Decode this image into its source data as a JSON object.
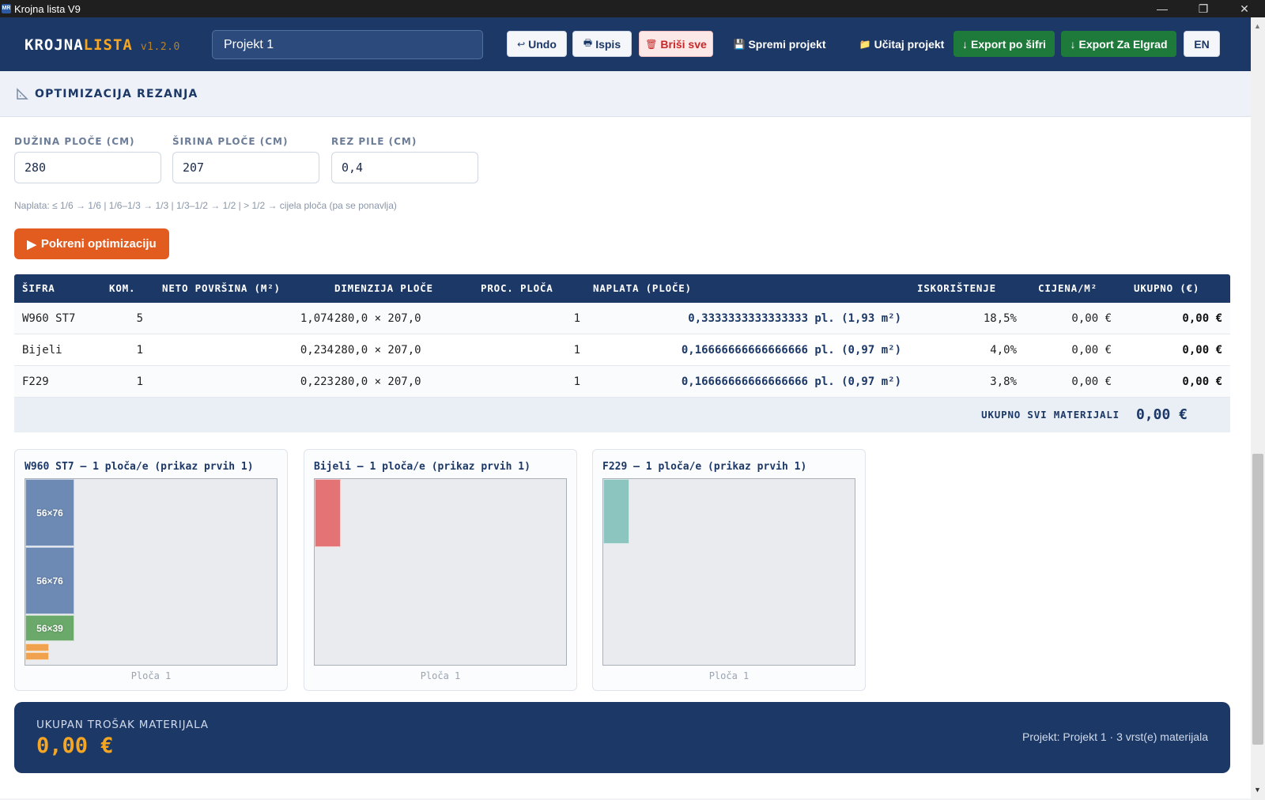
{
  "window": {
    "title": "Krojna lista V9",
    "controls": {
      "minimize": "—",
      "maximize": "❐",
      "close": "✕"
    }
  },
  "header": {
    "logo_main": "KROJNA",
    "logo_accent": "LISTA",
    "version": "v1.2.0",
    "project_name": "Projekt 1",
    "buttons": {
      "undo": "Undo",
      "print": "Ispis",
      "delete_all": "Briši sve",
      "save": "Spremi projekt",
      "load": "Učitaj projekt",
      "export_code": "Export po šifri",
      "export_elgrad": "Export Za Elgrad",
      "lang": "EN"
    },
    "icons": {
      "undo": "↩",
      "print": "🖶",
      "delete": "🗑",
      "save": "💾",
      "load": "📁",
      "export": "↓"
    }
  },
  "section": {
    "title": "OPTIMIZACIJA REZANJA",
    "fields": {
      "length_label": "DUŽINA PLOČE (CM)",
      "length_value": "280",
      "width_label": "ŠIRINA PLOČE (CM)",
      "width_value": "207",
      "kerf_label": "REZ PILE (CM)",
      "kerf_value": "0,4"
    },
    "hint": "Naplata: ≤ 1/6 → 1/6  |  1/6–1/3 → 1/3  |  1/3–1/2 → 1/2  |  > 1/2 → cijela ploča (pa se ponavlja)",
    "run_label": "Pokreni optimizaciju",
    "run_icon": "▶"
  },
  "table": {
    "headers": [
      "ŠIFRA",
      "KOM.",
      "NETO POVRŠINA (M²)",
      "DIMENZIJA PLOČE",
      "PROC. PLOČA",
      "NAPLATA (PLOČE)",
      "ISKORIŠTENJE",
      "CIJENA/M²",
      "UKUPNO (€)"
    ],
    "rows": [
      {
        "code": "W960 ST7",
        "qty": "5",
        "net": "1,074",
        "dim": "280,0 × 207,0",
        "est": "1",
        "billing": "0,3333333333333333 pl. (1,93 m²)",
        "util": "18,5%",
        "price": "0,00 €",
        "total": "0,00 €"
      },
      {
        "code": "Bijeli",
        "qty": "1",
        "net": "0,234",
        "dim": "280,0 × 207,0",
        "est": "1",
        "billing": "0,16666666666666666 pl. (0,97 m²)",
        "util": "4,0%",
        "price": "0,00 €",
        "total": "0,00 €"
      },
      {
        "code": "F229",
        "qty": "1",
        "net": "0,223",
        "dim": "280,0 × 207,0",
        "est": "1",
        "billing": "0,16666666666666666 pl. (0,97 m²)",
        "util": "3,8%",
        "price": "0,00 €",
        "total": "0,00 €"
      }
    ],
    "footer_label": "UKUPNO SVI MATERIJALI",
    "footer_value": "0,00 €"
  },
  "cards": [
    {
      "title": "W960 ST7 — 1 ploča/e (prikaz prvih 1)",
      "plate_label": "Ploča 1",
      "pieces": [
        "56×76",
        "56×76",
        "56×39"
      ]
    },
    {
      "title": "Bijeli — 1 ploča/e (prikaz prvih 1)",
      "plate_label": "Ploča 1"
    },
    {
      "title": "F229 — 1 ploča/e (prikaz prvih 1)",
      "plate_label": "Ploča 1"
    }
  ],
  "summary": {
    "label": "UKUPAN TROŠAK MATERIJALA",
    "value": "0,00 €",
    "info": "Projekt: Projekt 1 · 3 vrst(e) materijala"
  },
  "colors": {
    "navy": "#1c3867",
    "accent": "#f5a623",
    "run_button": "#e25c20",
    "export_green": "#1e7a3a",
    "piece_blue": "#6c8ab4",
    "piece_green": "#6aa96a",
    "piece_orange": "#f0a24e",
    "piece_red": "#e47375",
    "piece_teal": "#8cc5bf"
  }
}
